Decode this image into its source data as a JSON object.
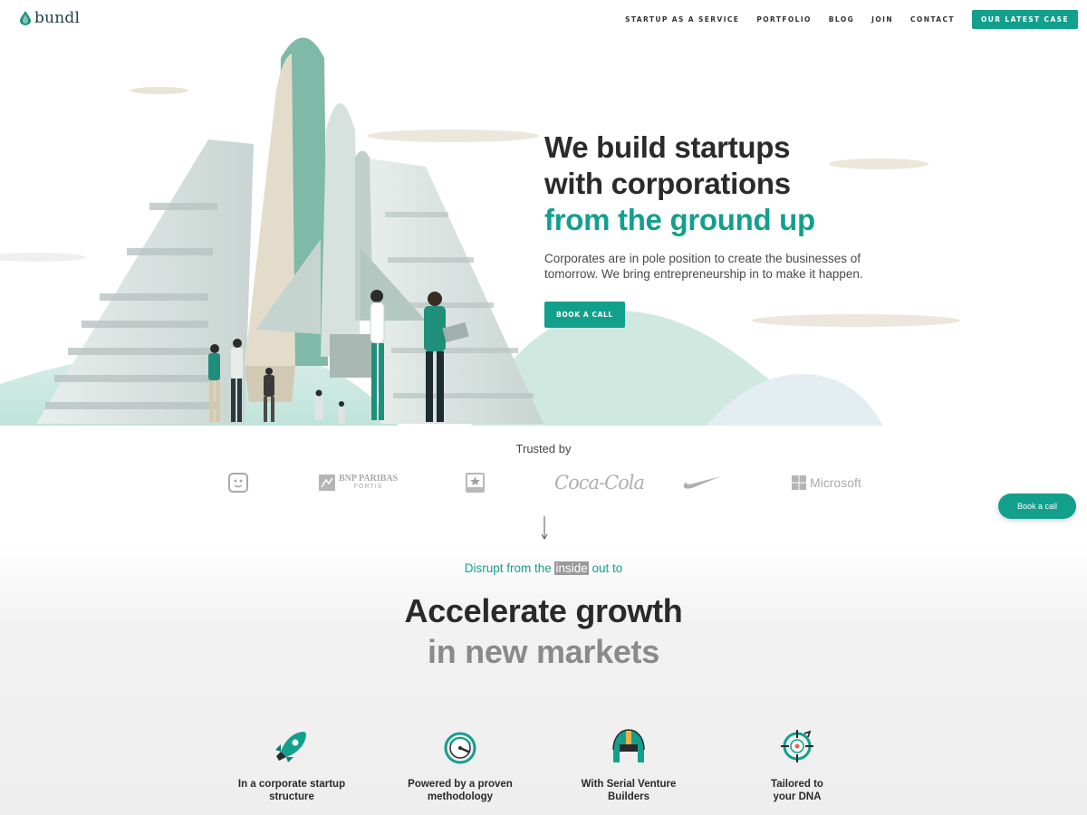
{
  "brand": {
    "name": "bundl"
  },
  "nav": {
    "links": [
      "STARTUP AS A SERVICE",
      "PORTFOLIO",
      "BLOG",
      "JOIN",
      "CONTACT"
    ],
    "cta": "OUR LATEST CASE"
  },
  "hero": {
    "line1": "We build startups",
    "line2": "with corporations",
    "line3": "from the ground up",
    "subtitle": "Corporates are in pole position to create the businesses of tomorrow. We bring entrepreneurship in to make it happen.",
    "button": "BOOK A CALL"
  },
  "trusted": {
    "title": "Trusted by",
    "logos": [
      {
        "icon": "smiley-square-logo"
      },
      {
        "icon": "bnp-paribas-logo",
        "text1": "BNP PARIBAS",
        "text2": "FORTIS"
      },
      {
        "icon": "star-badge-logo"
      },
      {
        "icon": "coca-cola-logo",
        "text": "Coca-Cola"
      },
      {
        "icon": "nike-swoosh-logo"
      },
      {
        "icon": "microsoft-logo",
        "text": "Microsoft"
      }
    ]
  },
  "floating_cta": "Book a call",
  "tagline": {
    "before": "Disrupt from the ",
    "highlight": "inside",
    "after": " out to"
  },
  "headline": {
    "main": "Accelerate growth",
    "sub": "in new markets"
  },
  "features": [
    {
      "icon": "rocket-icon",
      "line1": "In a corporate startup",
      "line2": "structure"
    },
    {
      "icon": "speedometer-icon",
      "line1": "Powered by a proven",
      "line2": "methodology"
    },
    {
      "icon": "helmet-icon",
      "line1": "With Serial Venture",
      "line2": "Builders"
    },
    {
      "icon": "target-icon",
      "line1": "Tailored to",
      "line2": "your DNA"
    }
  ],
  "colors": {
    "accent": "#12a08d",
    "dark": "#2a2a2a",
    "muted": "#8a8a8a"
  }
}
